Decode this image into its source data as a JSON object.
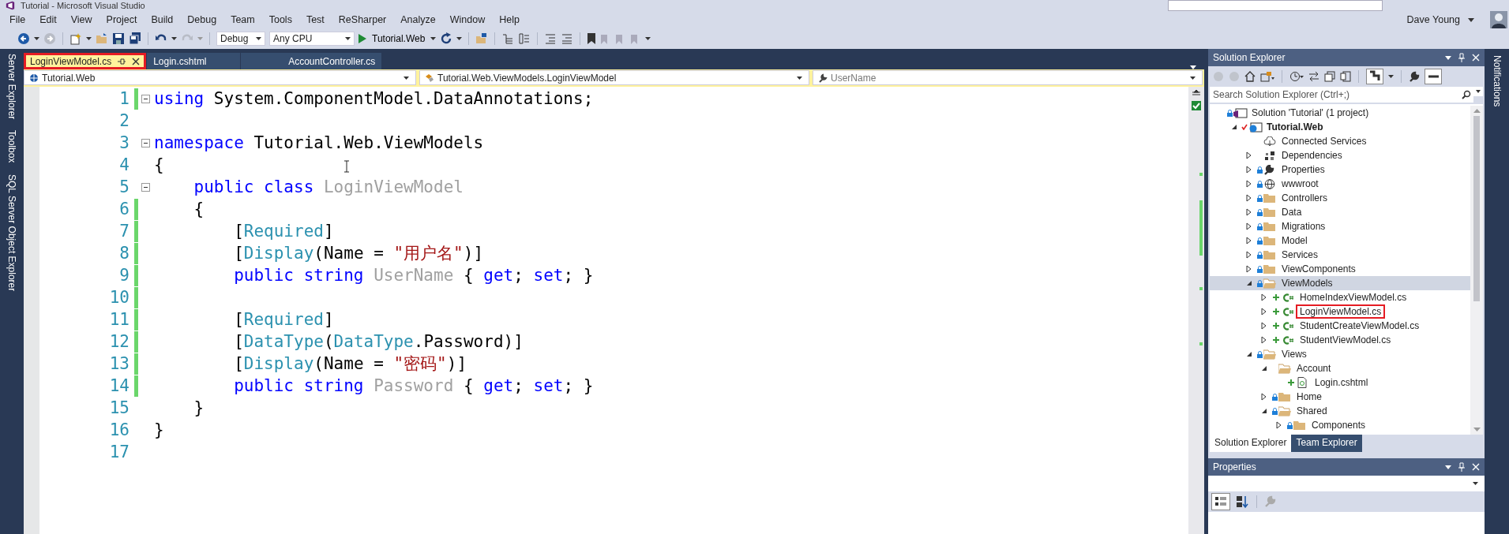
{
  "window": {
    "title": "Tutorial - Microsoft Visual Studio"
  },
  "menu": [
    "File",
    "Edit",
    "View",
    "Project",
    "Build",
    "Debug",
    "Team",
    "Tools",
    "Test",
    "ReSharper",
    "Analyze",
    "Window",
    "Help"
  ],
  "toolbar": {
    "configuration": "Debug",
    "platform": "Any CPU",
    "start": "Tutorial.Web"
  },
  "account": {
    "name": "Dave Young"
  },
  "side_tabs": [
    "Server Explorer",
    "Toolbox",
    "SQL Server Object Explorer"
  ],
  "tabs": [
    {
      "label": "LoginViewModel.cs",
      "selected": true,
      "highlighted": true
    },
    {
      "label": "Login.cshtml",
      "selected": false,
      "highlighted": false
    },
    {
      "label": "AccountController.cs",
      "selected": false,
      "highlighted": false
    }
  ],
  "nav_bar": {
    "project": "Tutorial.Web",
    "type": "Tutorial.Web.ViewModels.LoginViewModel",
    "member": "UserName"
  },
  "editor": {
    "lines": [
      {
        "number": "1",
        "changed": true,
        "fold": true,
        "tokens": [
          {
            "text": "using",
            "kind": "keyword"
          },
          {
            "text": " System.ComponentModel.DataAnnotations;",
            "kind": "plain"
          }
        ]
      },
      {
        "number": "2",
        "changed": false,
        "fold": false
      },
      {
        "number": "3",
        "changed": false,
        "fold": true,
        "tokens": [
          {
            "text": "namespace",
            "kind": "keyword"
          },
          {
            "text": " Tutorial.Web.ViewModels",
            "kind": "plain"
          }
        ]
      },
      {
        "number": "4",
        "changed": false,
        "fold": false,
        "tokens": [
          {
            "text": "{",
            "kind": "plain"
          }
        ]
      },
      {
        "number": "5",
        "changed": false,
        "fold": true,
        "tokens": [
          {
            "text": "    public class",
            "kind": "keyword"
          },
          {
            "text": " LoginViewModel",
            "kind": "unused"
          }
        ]
      },
      {
        "number": "6",
        "changed": true,
        "fold": false,
        "tokens": [
          {
            "text": "    {",
            "kind": "plain"
          }
        ]
      },
      {
        "number": "7",
        "changed": true,
        "fold": false,
        "tokens": [
          {
            "text": "        [",
            "kind": "plain"
          },
          {
            "text": "Required",
            "kind": "type"
          },
          {
            "text": "]",
            "kind": "plain"
          }
        ]
      },
      {
        "number": "8",
        "changed": true,
        "fold": false,
        "tokens": [
          {
            "text": "        [",
            "kind": "plain"
          },
          {
            "text": "Display",
            "kind": "type"
          },
          {
            "text": "(Name = ",
            "kind": "plain"
          },
          {
            "text": "\"用户名\"",
            "kind": "string"
          },
          {
            "text": ")]",
            "kind": "plain"
          }
        ]
      },
      {
        "number": "9",
        "changed": true,
        "fold": false,
        "tokens": [
          {
            "text": "        public string",
            "kind": "keyword"
          },
          {
            "text": " UserName",
            "kind": "unused"
          },
          {
            "text": " { ",
            "kind": "plain"
          },
          {
            "text": "get",
            "kind": "keyword"
          },
          {
            "text": "; ",
            "kind": "plain"
          },
          {
            "text": "set",
            "kind": "keyword"
          },
          {
            "text": "; }",
            "kind": "plain"
          }
        ]
      },
      {
        "number": "10",
        "changed": true,
        "fold": false
      },
      {
        "number": "11",
        "changed": true,
        "fold": false,
        "tokens": [
          {
            "text": "        [",
            "kind": "plain"
          },
          {
            "text": "Required",
            "kind": "type"
          },
          {
            "text": "]",
            "kind": "plain"
          }
        ]
      },
      {
        "number": "12",
        "changed": true,
        "fold": false,
        "tokens": [
          {
            "text": "        [",
            "kind": "plain"
          },
          {
            "text": "DataType",
            "kind": "type"
          },
          {
            "text": "(",
            "kind": "plain"
          },
          {
            "text": "DataType",
            "kind": "type"
          },
          {
            "text": ".Password)]",
            "kind": "plain"
          }
        ]
      },
      {
        "number": "13",
        "changed": true,
        "fold": false,
        "tokens": [
          {
            "text": "        [",
            "kind": "plain"
          },
          {
            "text": "Display",
            "kind": "type"
          },
          {
            "text": "(Name = ",
            "kind": "plain"
          },
          {
            "text": "\"密码\"",
            "kind": "string"
          },
          {
            "text": ")]",
            "kind": "plain"
          }
        ]
      },
      {
        "number": "14",
        "changed": true,
        "fold": false,
        "tokens": [
          {
            "text": "        public string",
            "kind": "keyword"
          },
          {
            "text": " Password",
            "kind": "unused"
          },
          {
            "text": " { ",
            "kind": "plain"
          },
          {
            "text": "get",
            "kind": "keyword"
          },
          {
            "text": "; ",
            "kind": "plain"
          },
          {
            "text": "set",
            "kind": "keyword"
          },
          {
            "text": "; }",
            "kind": "plain"
          }
        ]
      },
      {
        "number": "15",
        "changed": false,
        "fold": false,
        "tokens": [
          {
            "text": "    }",
            "kind": "plain"
          }
        ]
      },
      {
        "number": "16",
        "changed": false,
        "fold": false,
        "tokens": [
          {
            "text": "}",
            "kind": "plain"
          }
        ]
      },
      {
        "number": "17",
        "changed": false,
        "fold": false
      }
    ]
  },
  "solution_explorer": {
    "title": "Solution Explorer",
    "search": {
      "placeholder": "Search Solution Explorer (Ctrl+;)"
    },
    "tree": [
      {
        "label": "Solution 'Tutorial' (1 project)",
        "kind": "solution",
        "badge": {
          "kind": "lock"
        },
        "selected": false,
        "highlighted": false,
        "children": [
          {
            "label": "Tutorial.Web",
            "kind": "project",
            "badge": {
              "kind": "check"
            },
            "expanded": true,
            "selected": false,
            "highlighted": false,
            "children": [
              {
                "label": "Connected Services",
                "kind": "cloud",
                "selected": false,
                "highlighted": false
              },
              {
                "label": "Dependencies",
                "kind": "dependencies",
                "expanded": false,
                "selected": false,
                "highlighted": false
              },
              {
                "label": "Properties",
                "kind": "wrench",
                "badge": {
                  "kind": "lock"
                },
                "expanded": false,
                "selected": false,
                "highlighted": false
              },
              {
                "label": "wwwroot",
                "kind": "globe",
                "badge": {
                  "kind": "lock"
                },
                "expanded": false,
                "selected": false,
                "highlighted": false
              },
              {
                "label": "Controllers",
                "kind": "folder",
                "badge": {
                  "kind": "lock"
                },
                "expanded": false,
                "selected": false,
                "highlighted": false
              },
              {
                "label": "Data",
                "kind": "folder",
                "badge": {
                  "kind": "lock"
                },
                "expanded": false,
                "selected": false,
                "highlighted": false
              },
              {
                "label": "Migrations",
                "kind": "folder",
                "badge": {
                  "kind": "lock"
                },
                "expanded": false,
                "selected": false,
                "highlighted": false
              },
              {
                "label": "Model",
                "kind": "folder",
                "badge": {
                  "kind": "lock"
                },
                "expanded": false,
                "selected": false,
                "highlighted": false
              },
              {
                "label": "Services",
                "kind": "folder",
                "badge": {
                  "kind": "lock"
                },
                "expanded": false,
                "selected": false,
                "highlighted": false
              },
              {
                "label": "ViewComponents",
                "kind": "folder",
                "badge": {
                  "kind": "lock"
                },
                "expanded": false,
                "selected": false,
                "highlighted": false
              },
              {
                "label": "ViewModels",
                "kind": "folder",
                "badge": {
                  "kind": "lock"
                },
                "expanded": true,
                "selected": true,
                "highlighted": false,
                "children": [
                  {
                    "label": "HomeIndexViewModel.cs",
                    "kind": "csharp",
                    "badge": {
                      "kind": "add"
                    },
                    "expanded": false,
                    "selected": false,
                    "highlighted": false
                  },
                  {
                    "label": "LoginViewModel.cs",
                    "kind": "csharp",
                    "badge": {
                      "kind": "add"
                    },
                    "expanded": false,
                    "selected": false,
                    "highlighted": true
                  },
                  {
                    "label": "StudentCreateViewModel.cs",
                    "kind": "csharp",
                    "badge": {
                      "kind": "add"
                    },
                    "expanded": false,
                    "selected": false,
                    "highlighted": false
                  },
                  {
                    "label": "StudentViewModel.cs",
                    "kind": "csharp",
                    "badge": {
                      "kind": "add"
                    },
                    "expanded": false,
                    "selected": false,
                    "highlighted": false
                  }
                ]
              },
              {
                "label": "Views",
                "kind": "folder",
                "badge": {
                  "kind": "lock"
                },
                "expanded": true,
                "selected": false,
                "highlighted": false,
                "children": [
                  {
                    "label": "Account",
                    "kind": "folder",
                    "expanded": true,
                    "selected": false,
                    "highlighted": false,
                    "children": [
                      {
                        "label": "Login.cshtml",
                        "kind": "razor",
                        "badge": {
                          "kind": "add"
                        },
                        "selected": false,
                        "highlighted": false
                      }
                    ]
                  },
                  {
                    "label": "Home",
                    "kind": "folder",
                    "badge": {
                      "kind": "lock"
                    },
                    "expanded": false,
                    "selected": false,
                    "highlighted": false
                  },
                  {
                    "label": "Shared",
                    "kind": "folder",
                    "badge": {
                      "kind": "lock"
                    },
                    "expanded": true,
                    "selected": false,
                    "highlighted": false,
                    "children": [
                      {
                        "label": "Components",
                        "kind": "folder",
                        "badge": {
                          "kind": "lock"
                        },
                        "expanded": false,
                        "selected": false,
                        "highlighted": false
                      }
                    ]
                  }
                ]
              }
            ]
          }
        ]
      }
    ],
    "bottom_tabs": [
      {
        "label": "Solution Explorer",
        "selected": true
      },
      {
        "label": "Team Explorer",
        "selected": false
      }
    ]
  },
  "properties": {
    "title": "Properties"
  },
  "notifications_tab": "Notifications"
}
